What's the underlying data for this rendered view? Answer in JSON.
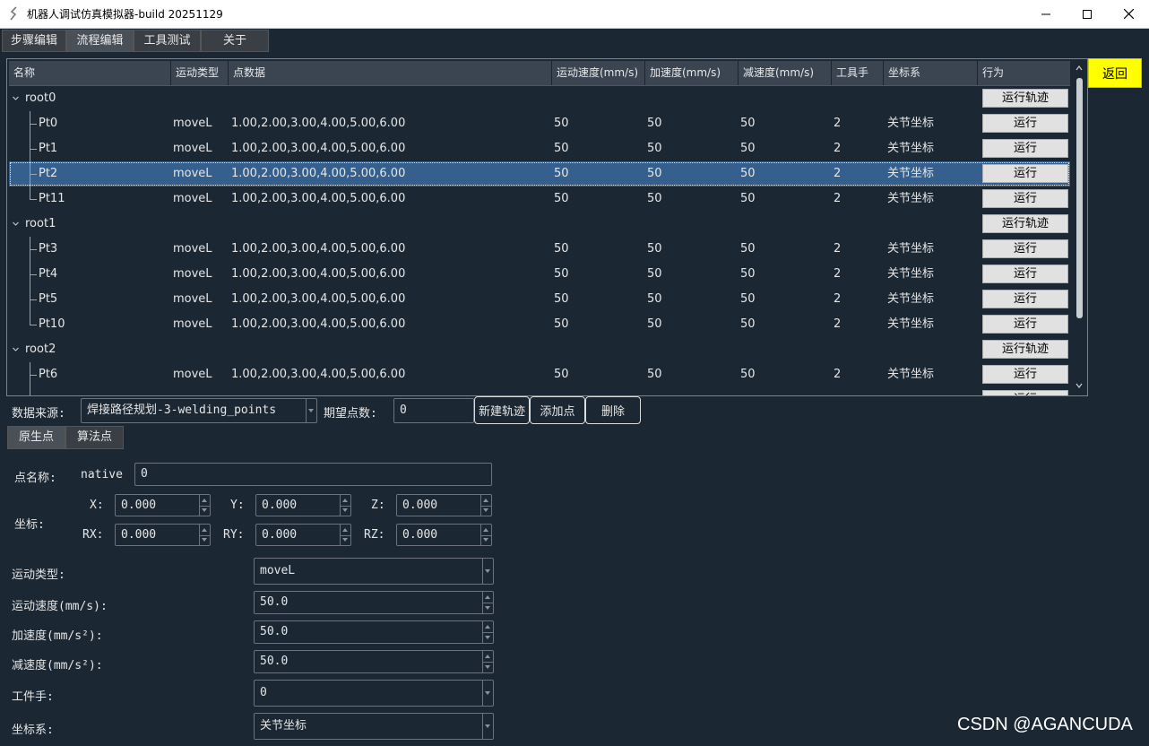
{
  "window": {
    "title": "机器人调试仿真模拟器-build 20251129"
  },
  "tabs": [
    "步骤编辑",
    "流程编辑",
    "工具测试",
    "关于"
  ],
  "back_button": "返回",
  "table": {
    "headers": [
      "名称",
      "运动类型",
      "点数据",
      "运动速度(mm/s)",
      "加速度(mm/s)",
      "减速度(mm/s)",
      "工具手",
      "坐标系",
      "行为"
    ],
    "rows": [
      {
        "kind": "group",
        "name": "root0",
        "action": "运行轨迹"
      },
      {
        "kind": "point",
        "name": "Pt0",
        "motion": "moveL",
        "data": "1.00,2.00,3.00,4.00,5.00,6.00",
        "speed": "50",
        "acc": "50",
        "dec": "50",
        "tool": "2",
        "coord": "关节坐标",
        "action": "运行"
      },
      {
        "kind": "point",
        "name": "Pt1",
        "motion": "moveL",
        "data": "1.00,2.00,3.00,4.00,5.00,6.00",
        "speed": "50",
        "acc": "50",
        "dec": "50",
        "tool": "2",
        "coord": "关节坐标",
        "action": "运行"
      },
      {
        "kind": "point",
        "name": "Pt2",
        "motion": "moveL",
        "data": "1.00,2.00,3.00,4.00,5.00,6.00",
        "speed": "50",
        "acc": "50",
        "dec": "50",
        "tool": "2",
        "coord": "关节坐标",
        "action": "运行",
        "selected": true
      },
      {
        "kind": "point",
        "name": "Pt11",
        "motion": "moveL",
        "data": "1.00,2.00,3.00,4.00,5.00,6.00",
        "speed": "50",
        "acc": "50",
        "dec": "50",
        "tool": "2",
        "coord": "关节坐标",
        "action": "运行",
        "last": true
      },
      {
        "kind": "group",
        "name": "root1",
        "action": "运行轨迹"
      },
      {
        "kind": "point",
        "name": "Pt3",
        "motion": "moveL",
        "data": "1.00,2.00,3.00,4.00,5.00,6.00",
        "speed": "50",
        "acc": "50",
        "dec": "50",
        "tool": "2",
        "coord": "关节坐标",
        "action": "运行"
      },
      {
        "kind": "point",
        "name": "Pt4",
        "motion": "moveL",
        "data": "1.00,2.00,3.00,4.00,5.00,6.00",
        "speed": "50",
        "acc": "50",
        "dec": "50",
        "tool": "2",
        "coord": "关节坐标",
        "action": "运行"
      },
      {
        "kind": "point",
        "name": "Pt5",
        "motion": "moveL",
        "data": "1.00,2.00,3.00,4.00,5.00,6.00",
        "speed": "50",
        "acc": "50",
        "dec": "50",
        "tool": "2",
        "coord": "关节坐标",
        "action": "运行"
      },
      {
        "kind": "point",
        "name": "Pt10",
        "motion": "moveL",
        "data": "1.00,2.00,3.00,4.00,5.00,6.00",
        "speed": "50",
        "acc": "50",
        "dec": "50",
        "tool": "2",
        "coord": "关节坐标",
        "action": "运行",
        "last": true
      },
      {
        "kind": "group",
        "name": "root2",
        "action": "运行轨迹"
      },
      {
        "kind": "point",
        "name": "Pt6",
        "motion": "moveL",
        "data": "1.00,2.00,3.00,4.00,5.00,6.00",
        "speed": "50",
        "acc": "50",
        "dec": "50",
        "tool": "2",
        "coord": "关节坐标",
        "action": "运行"
      },
      {
        "kind": "point",
        "name": "",
        "motion": "",
        "data": "",
        "speed": "",
        "acc": "",
        "dec": "",
        "tool": "",
        "coord": "",
        "action": "运行"
      }
    ]
  },
  "toolbar": {
    "source_label": "数据来源:",
    "source_value": "焊接路径规划-3-welding_points",
    "count_label": "期望点数:",
    "count_value": "0",
    "new_button": "新建轨迹",
    "add_button": "添加点",
    "delete_button": "删除"
  },
  "subtabs": [
    "原生点",
    "算法点"
  ],
  "form": {
    "name_label": "点名称:",
    "name_prefix": "native",
    "name_value": "0",
    "coord_label": "坐标:",
    "x_label": "X:",
    "x_value": "0.000",
    "y_label": "Y:",
    "y_value": "0.000",
    "z_label": "Z:",
    "z_value": "0.000",
    "rx_label": "RX:",
    "rx_value": "0.000",
    "ry_label": "RY:",
    "ry_value": "0.000",
    "rz_label": "RZ:",
    "rz_value": "0.000",
    "motion_label": "运动类型:",
    "motion_value": "moveL",
    "speed_label": "运动速度(mm/s):",
    "speed_value": "50.0",
    "acc_label": "加速度(mm/s²):",
    "acc_value": "50.0",
    "dec_label": "减速度(mm/s²):",
    "dec_value": "50.0",
    "tool_label": "工件手:",
    "tool_value": "0",
    "coordsys_label": "坐标系:",
    "coordsys_value": "关节坐标"
  },
  "watermark": "CSDN @AGANCUDA",
  "colors": {
    "background": "#1b2733",
    "selection": "#355f8c",
    "back_button": "#ffff00"
  }
}
